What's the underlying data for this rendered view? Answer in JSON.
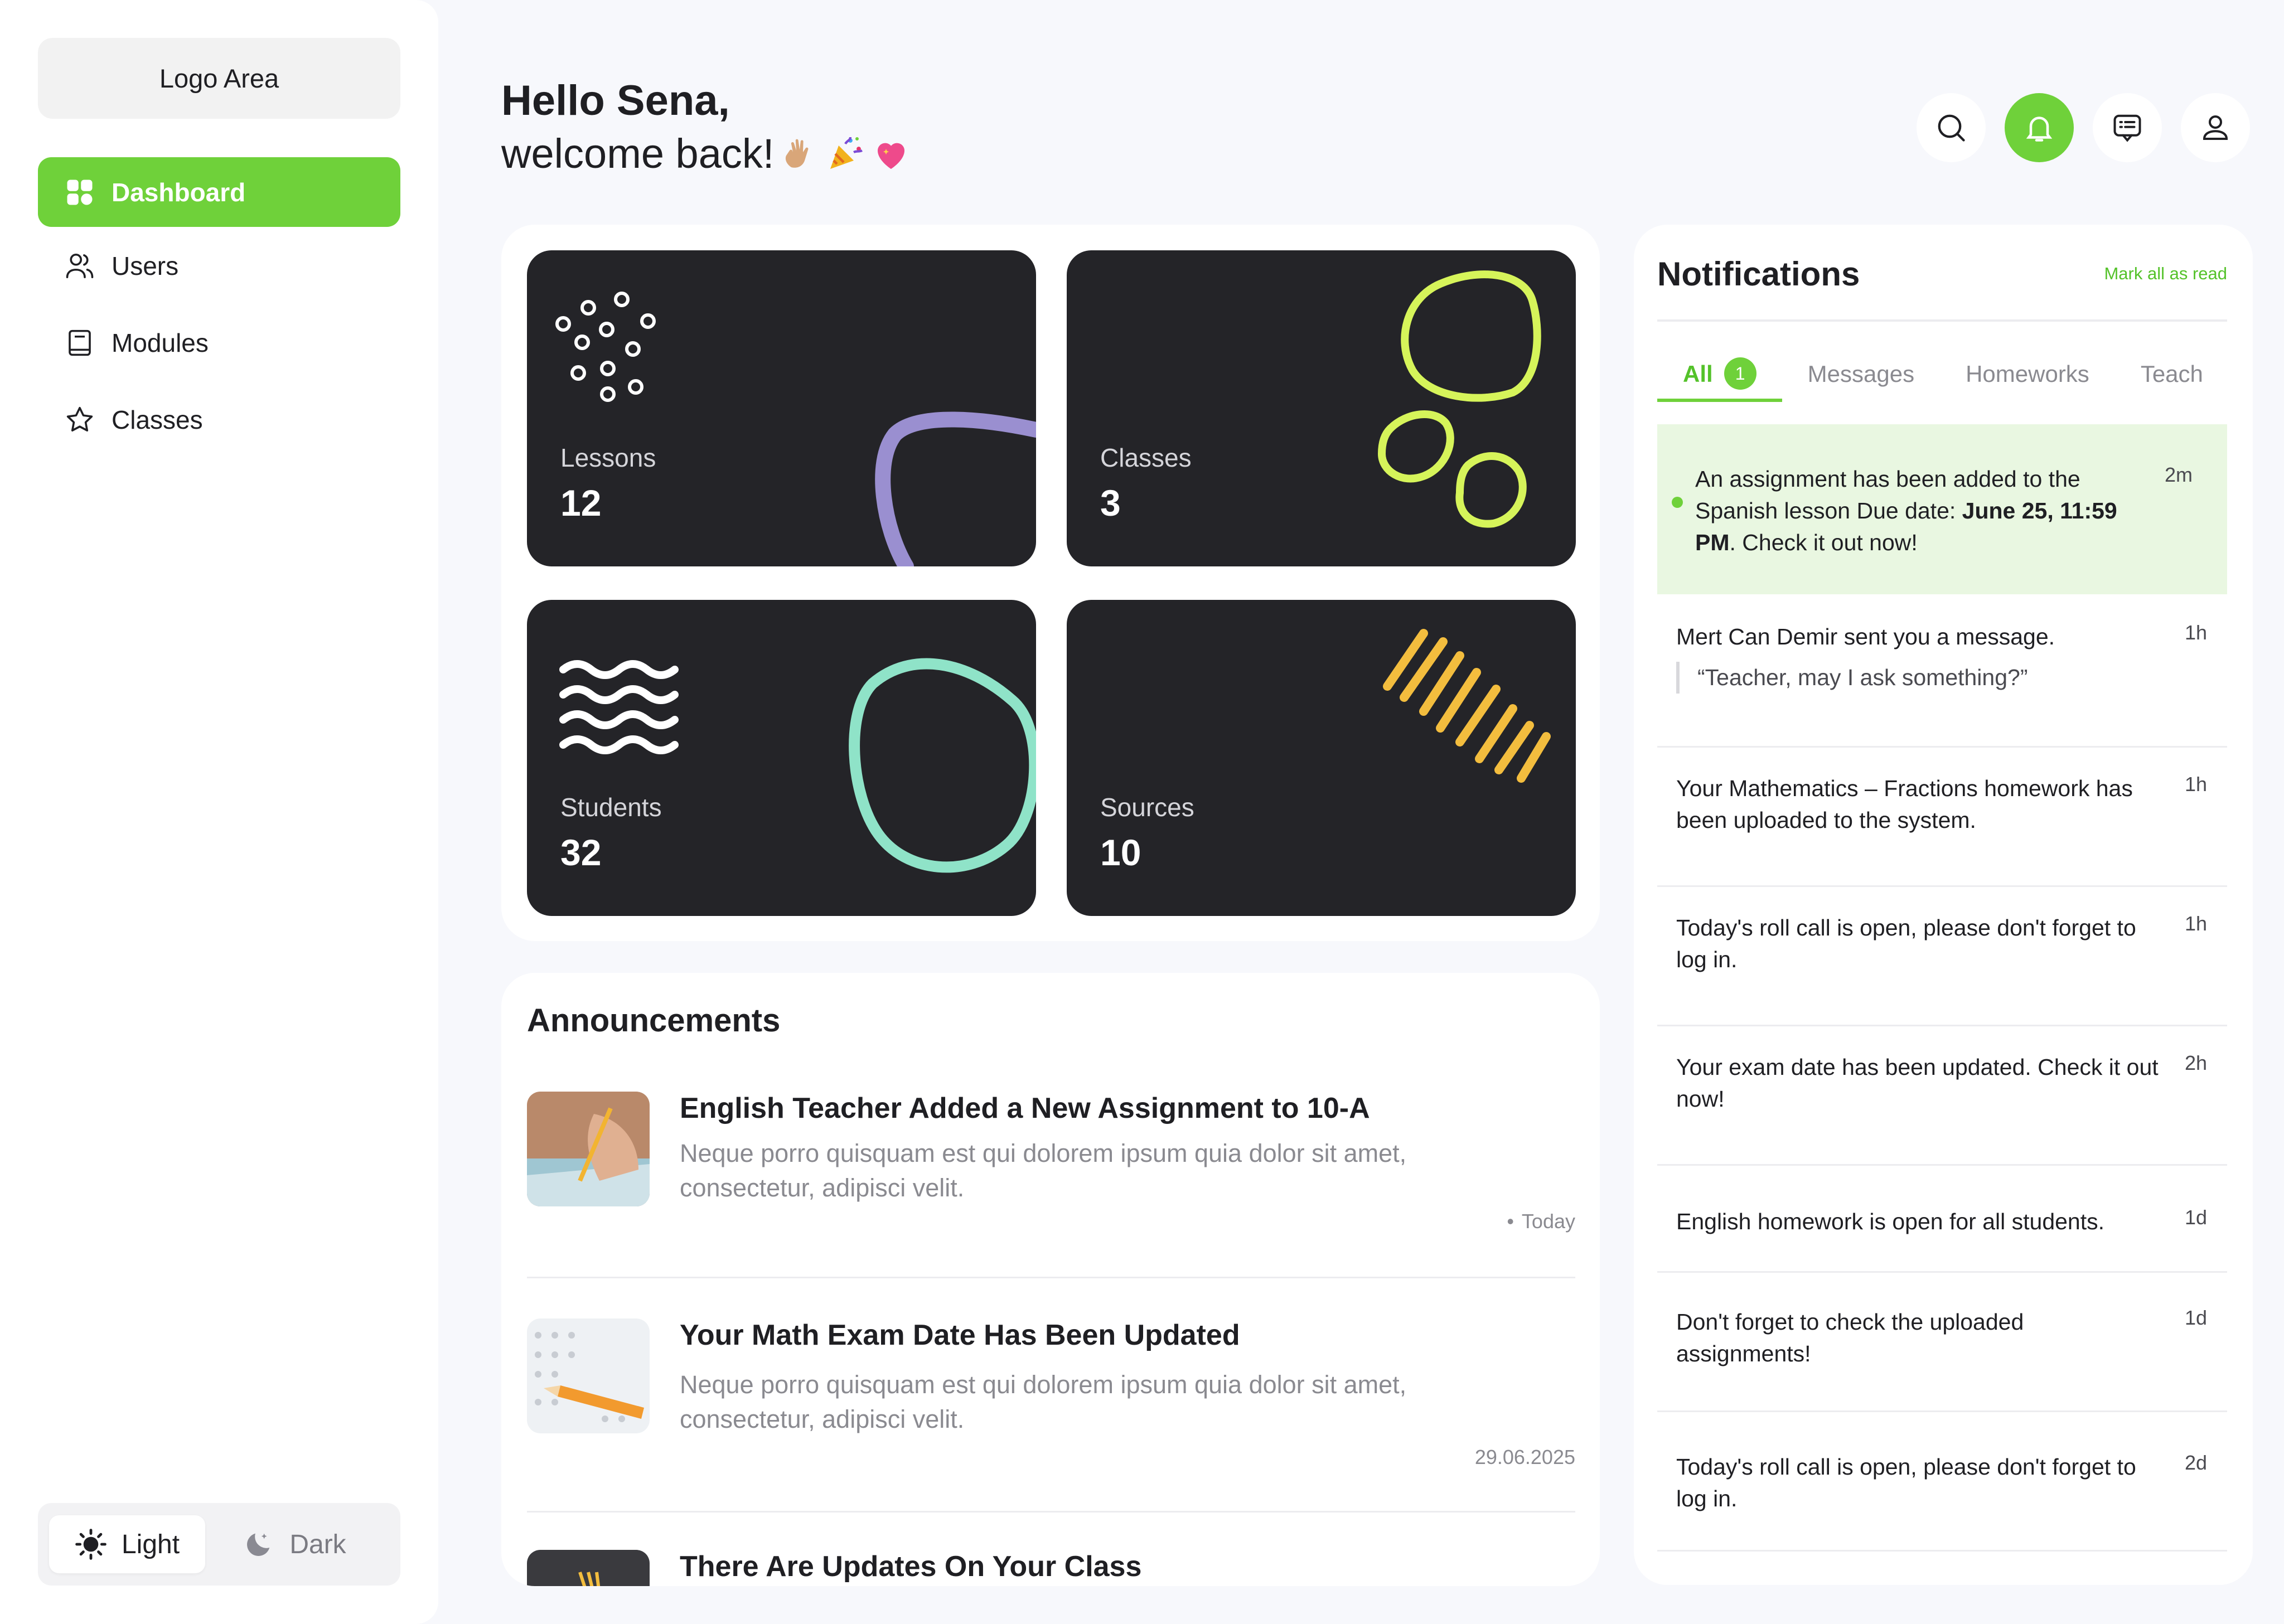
{
  "sidebar": {
    "logo": "Logo Area",
    "nav": [
      {
        "label": "Dashboard",
        "icon": "grid-icon",
        "active": true
      },
      {
        "label": "Users",
        "icon": "users-icon"
      },
      {
        "label": "Modules",
        "icon": "book-icon"
      },
      {
        "label": "Classes",
        "icon": "star-icon"
      }
    ],
    "theme": {
      "light": "Light",
      "dark": "Dark",
      "selected": "light"
    }
  },
  "header": {
    "greeting_line1": "Hello Sena,",
    "greeting_line2": "welcome back!",
    "icons": [
      "search-icon",
      "bell-icon",
      "message-icon",
      "profile-icon"
    ]
  },
  "stats": [
    {
      "label": "Lessons",
      "value": "12"
    },
    {
      "label": "Classes",
      "value": "3"
    },
    {
      "label": "Students",
      "value": "32"
    },
    {
      "label": "Sources",
      "value": "10"
    }
  ],
  "announcements": {
    "title": "Announcements",
    "items": [
      {
        "title": "English Teacher Added a New Assignment to 10-A",
        "body": "Neque porro quisquam est qui dolorem ipsum quia dolor sit amet, consectetur, adipisci velit.",
        "date": "Today"
      },
      {
        "title": "Your Math Exam Date Has Been Updated",
        "body": "Neque porro quisquam est qui dolorem ipsum quia dolor sit amet, consectetur, adipisci velit.",
        "date": "29.06.2025"
      },
      {
        "title": "There Are Updates On Your Class",
        "body": "",
        "date": ""
      }
    ]
  },
  "notifications": {
    "title": "Notifications",
    "mark_all": "Mark all as read",
    "tabs": [
      {
        "label": "All",
        "badge": "1"
      },
      {
        "label": "Messages"
      },
      {
        "label": "Homeworks"
      },
      {
        "label": "Teach"
      }
    ],
    "items": [
      {
        "pre": "An assignment has been added to the Spanish lesson Due date: ",
        "bold": "June 25, 11:59 PM",
        "post": ". Check it out now!",
        "time": "2m"
      },
      {
        "text": "Mert Can Demir sent you a message.",
        "quote": "“Teacher, may I ask something?”",
        "time": "1h"
      },
      {
        "text": "Your Mathematics – Fractions homework has been uploaded to the system.",
        "time": "1h"
      },
      {
        "text": "Today's roll call is open, please don't forget to log in.",
        "time": "1h"
      },
      {
        "text": "Your exam date has been updated. Check it out now!",
        "time": "2h"
      },
      {
        "text": "English homework is open for all students.",
        "time": "1d"
      },
      {
        "text": "Don't forget to check the uploaded assignments!",
        "time": "1d"
      },
      {
        "text": "Today's roll call is open, please don't forget to log in.",
        "time": "2d"
      }
    ]
  },
  "colors": {
    "accent": "#6fd13a",
    "card": "#242428",
    "bg": "#f7f8fc"
  }
}
